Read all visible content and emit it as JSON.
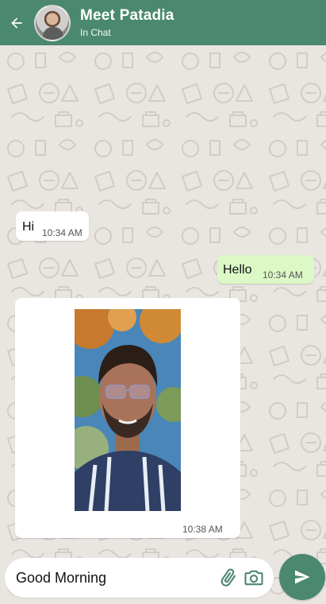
{
  "header": {
    "name": "Meet Patadia",
    "status": "In Chat"
  },
  "messages": [
    {
      "direction": "incoming",
      "type": "text",
      "text": "Hi",
      "time": "10:34 AM"
    },
    {
      "direction": "outgoing",
      "type": "text",
      "text": "Hello",
      "time": "10:34 AM"
    },
    {
      "direction": "incoming",
      "type": "image",
      "time": "10:38 AM"
    }
  ],
  "composer": {
    "value": "Good Morning"
  },
  "colors": {
    "header": "#4B8870",
    "incoming_bubble": "#FFFFFF",
    "outgoing_bubble": "#DCF8C6",
    "wallpaper": "#E9E5E0",
    "icon_accent": "#4B8870"
  },
  "icons": {
    "back": "arrow-left-icon",
    "attach": "paperclip-icon",
    "camera": "camera-icon",
    "send": "send-icon"
  }
}
